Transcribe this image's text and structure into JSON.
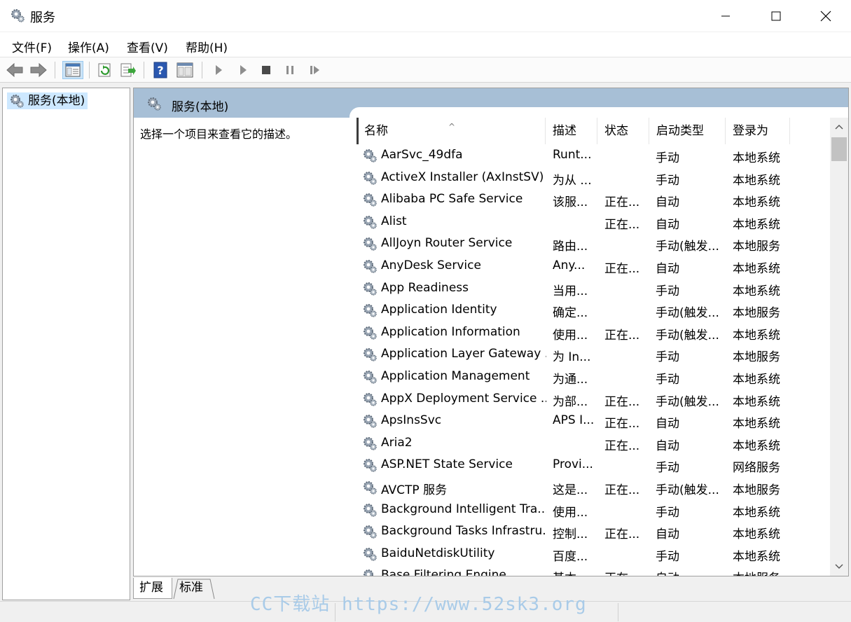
{
  "window": {
    "title": "服务",
    "icon": "gear-icon"
  },
  "menu": [
    {
      "label": "文件(F)"
    },
    {
      "label": "操作(A)"
    },
    {
      "label": "查看(V)"
    },
    {
      "label": "帮助(H)"
    }
  ],
  "toolbar": {
    "icons": [
      "back-arrow-icon",
      "forward-arrow-icon",
      "show-hide-tree-icon",
      "refresh-icon",
      "export-list-icon",
      "help-icon",
      "properties-icon",
      "start-service-icon",
      "start-service-alt-icon",
      "stop-service-icon",
      "pause-service-icon",
      "resume-service-icon"
    ]
  },
  "tree": {
    "item_label": "服务(本地)"
  },
  "main": {
    "header_title": "服务(本地)",
    "description_prompt": "选择一个项目来查看它的描述。"
  },
  "columns": [
    {
      "label": "名称"
    },
    {
      "label": "描述"
    },
    {
      "label": "状态"
    },
    {
      "label": "启动类型"
    },
    {
      "label": "登录为"
    }
  ],
  "services": [
    {
      "name": "AarSvc_49dfa",
      "desc": "Runt...",
      "status": "",
      "start": "手动",
      "logon": "本地系统"
    },
    {
      "name": "ActiveX Installer (AxInstSV)",
      "desc": "为从 ...",
      "status": "",
      "start": "手动",
      "logon": "本地系统"
    },
    {
      "name": "Alibaba PC Safe Service",
      "desc": "该服...",
      "status": "正在...",
      "start": "自动",
      "logon": "本地系统"
    },
    {
      "name": "Alist",
      "desc": "",
      "status": "正在...",
      "start": "自动",
      "logon": "本地系统"
    },
    {
      "name": "AllJoyn Router Service",
      "desc": "路由...",
      "status": "",
      "start": "手动(触发...",
      "logon": "本地服务"
    },
    {
      "name": "AnyDesk Service",
      "desc": "Any...",
      "status": "正在...",
      "start": "自动",
      "logon": "本地系统"
    },
    {
      "name": "App Readiness",
      "desc": "当用...",
      "status": "",
      "start": "手动",
      "logon": "本地系统"
    },
    {
      "name": "Application Identity",
      "desc": "确定...",
      "status": "",
      "start": "手动(触发...",
      "logon": "本地服务"
    },
    {
      "name": "Application Information",
      "desc": "使用...",
      "status": "正在...",
      "start": "手动(触发...",
      "logon": "本地系统"
    },
    {
      "name": "Application Layer Gateway ...",
      "desc": "为 In...",
      "status": "",
      "start": "手动",
      "logon": "本地服务"
    },
    {
      "name": "Application Management",
      "desc": "为通...",
      "status": "",
      "start": "手动",
      "logon": "本地系统"
    },
    {
      "name": "AppX Deployment Service ...",
      "desc": "为部...",
      "status": "正在...",
      "start": "手动(触发...",
      "logon": "本地系统"
    },
    {
      "name": "ApsInsSvc",
      "desc": "APS I...",
      "status": "正在...",
      "start": "自动",
      "logon": "本地系统"
    },
    {
      "name": "Aria2",
      "desc": "",
      "status": "正在...",
      "start": "自动",
      "logon": "本地系统"
    },
    {
      "name": "ASP.NET State Service",
      "desc": "Provi...",
      "status": "",
      "start": "手动",
      "logon": "网络服务"
    },
    {
      "name": "AVCTP 服务",
      "desc": "这是...",
      "status": "正在...",
      "start": "手动(触发...",
      "logon": "本地服务"
    },
    {
      "name": "Background Intelligent Tra...",
      "desc": "使用...",
      "status": "",
      "start": "手动",
      "logon": "本地系统"
    },
    {
      "name": "Background Tasks Infrastru...",
      "desc": "控制...",
      "status": "正在...",
      "start": "自动",
      "logon": "本地系统"
    },
    {
      "name": "BaiduNetdiskUtility",
      "desc": "百度...",
      "status": "",
      "start": "手动",
      "logon": "本地系统"
    },
    {
      "name": "Base Filtering Engine",
      "desc": "基本...",
      "status": "正在...",
      "start": "自动",
      "logon": "本地服务"
    }
  ],
  "tabs": [
    {
      "label": "扩展"
    },
    {
      "label": "标准"
    }
  ],
  "watermark": "CC下载站 https://www.52sk3.org"
}
